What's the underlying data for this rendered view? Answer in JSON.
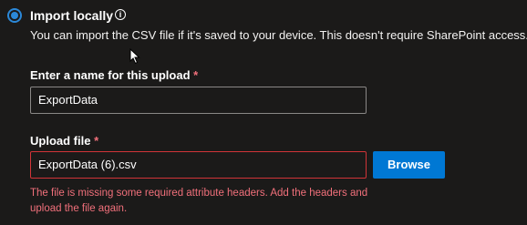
{
  "option": {
    "title": "Import locally",
    "info_icon": "info-icon",
    "description": "You can import the CSV file if it's saved to your device. This doesn't require SharePoint access."
  },
  "upload_name": {
    "label": "Enter a name for this upload",
    "required_marker": "*",
    "value": "ExportData"
  },
  "upload_file": {
    "label": "Upload file",
    "required_marker": "*",
    "value": "ExportData (6).csv",
    "browse_label": "Browse",
    "error": "The file is missing some required attribute headers. Add the headers and upload the file again."
  },
  "colors": {
    "background": "#1b1a19",
    "accent": "#0078d4",
    "error": "#f1707b"
  }
}
